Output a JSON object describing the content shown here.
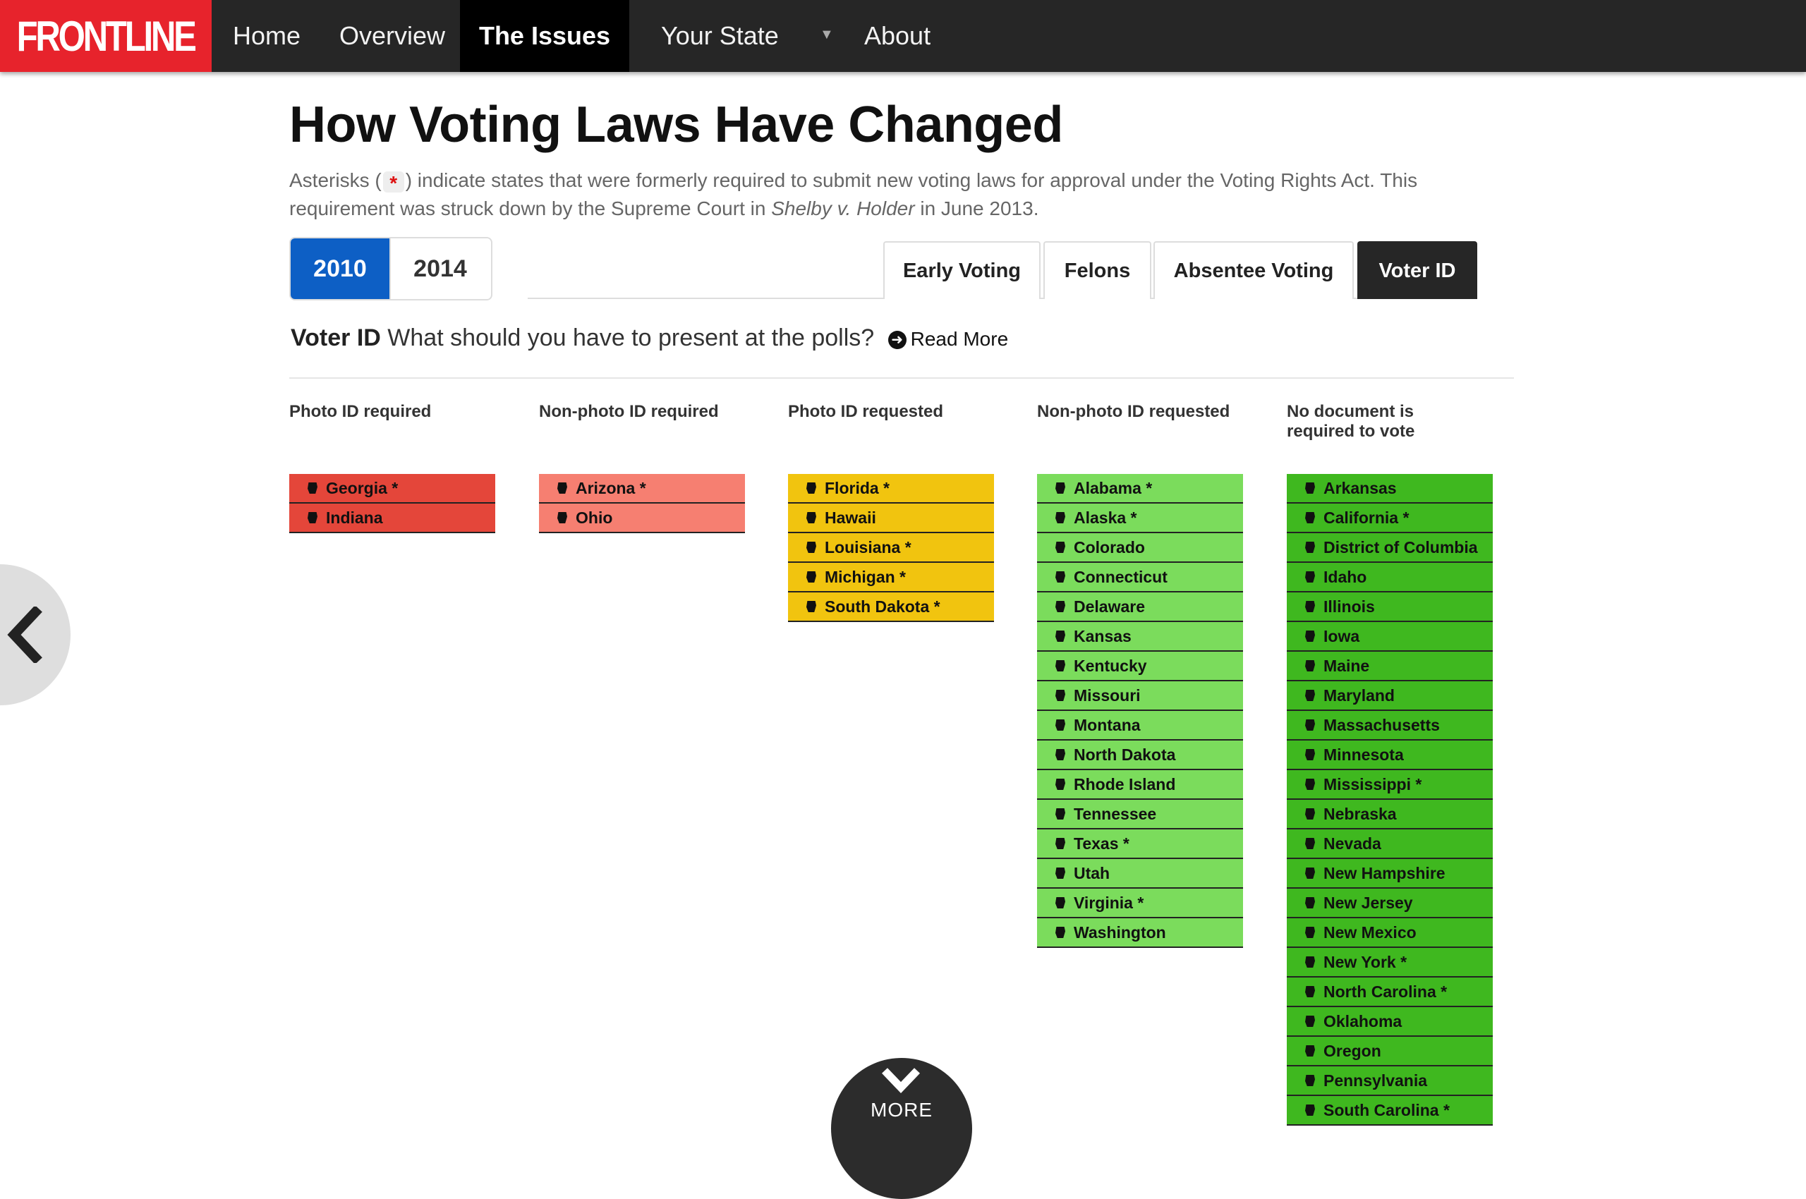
{
  "nav": {
    "brand": "FRONTLINE",
    "items": [
      "Home",
      "Overview",
      "The Issues",
      "Your State",
      "About"
    ],
    "active": "The Issues",
    "caret": "▼"
  },
  "title": "How Voting Laws Have Changed",
  "intro": {
    "part1": "Asterisks (",
    "asterisk": "*",
    "part2": ") indicate states that were formerly required to submit new voting laws for approval under the Voting Rights Act. This requirement was struck down by the Supreme Court in ",
    "case": "Shelby v. Holder",
    "part3": " in June 2013."
  },
  "years": {
    "options": [
      "2010",
      "2014"
    ],
    "selected": "2010"
  },
  "tabs": {
    "items": [
      "Early Voting",
      "Felons",
      "Absentee Voting",
      "Voter ID"
    ],
    "active": "Voter ID"
  },
  "question": {
    "topic": "Voter ID",
    "text": "What should you have to present at the polls?",
    "read_more": "Read More"
  },
  "columns": [
    {
      "heading": "Photo ID required",
      "color": "#e4463a",
      "states": [
        "Georgia *",
        "Indiana"
      ]
    },
    {
      "heading": "Non-photo ID required",
      "color": "#f67f71",
      "states": [
        "Arizona *",
        "Ohio"
      ]
    },
    {
      "heading": "Photo ID requested",
      "color": "#f1c40f",
      "states": [
        "Florida *",
        "Hawaii",
        "Louisiana *",
        "Michigan *",
        "South Dakota *"
      ]
    },
    {
      "heading": "Non-photo ID requested",
      "color": "#7bdc5c",
      "states": [
        "Alabama *",
        "Alaska *",
        "Colorado",
        "Connecticut",
        "Delaware",
        "Kansas",
        "Kentucky",
        "Missouri",
        "Montana",
        "North Dakota",
        "Rhode Island",
        "Tennessee",
        "Texas *",
        "Utah",
        "Virginia *",
        "Washington"
      ]
    },
    {
      "heading": "No document is required to vote",
      "color": "#3fb81f",
      "states": [
        "Arkansas",
        "California *",
        "District of Columbia",
        "Idaho",
        "Illinois",
        "Iowa",
        "Maine",
        "Maryland",
        "Massachusetts",
        "Minnesota",
        "Mississippi *",
        "Nebraska",
        "Nevada",
        "New Hampshire",
        "New Jersey",
        "New Mexico",
        "New York *",
        "North Carolina *",
        "Oklahoma",
        "Oregon",
        "Pennsylvania",
        "South Carolina *"
      ]
    }
  ],
  "more": "MORE",
  "icons": {
    "back": "chevron-left-icon",
    "more": "chevron-down-icon",
    "state": "state-shape-icon",
    "read_more": "arrow-circle-icon"
  }
}
